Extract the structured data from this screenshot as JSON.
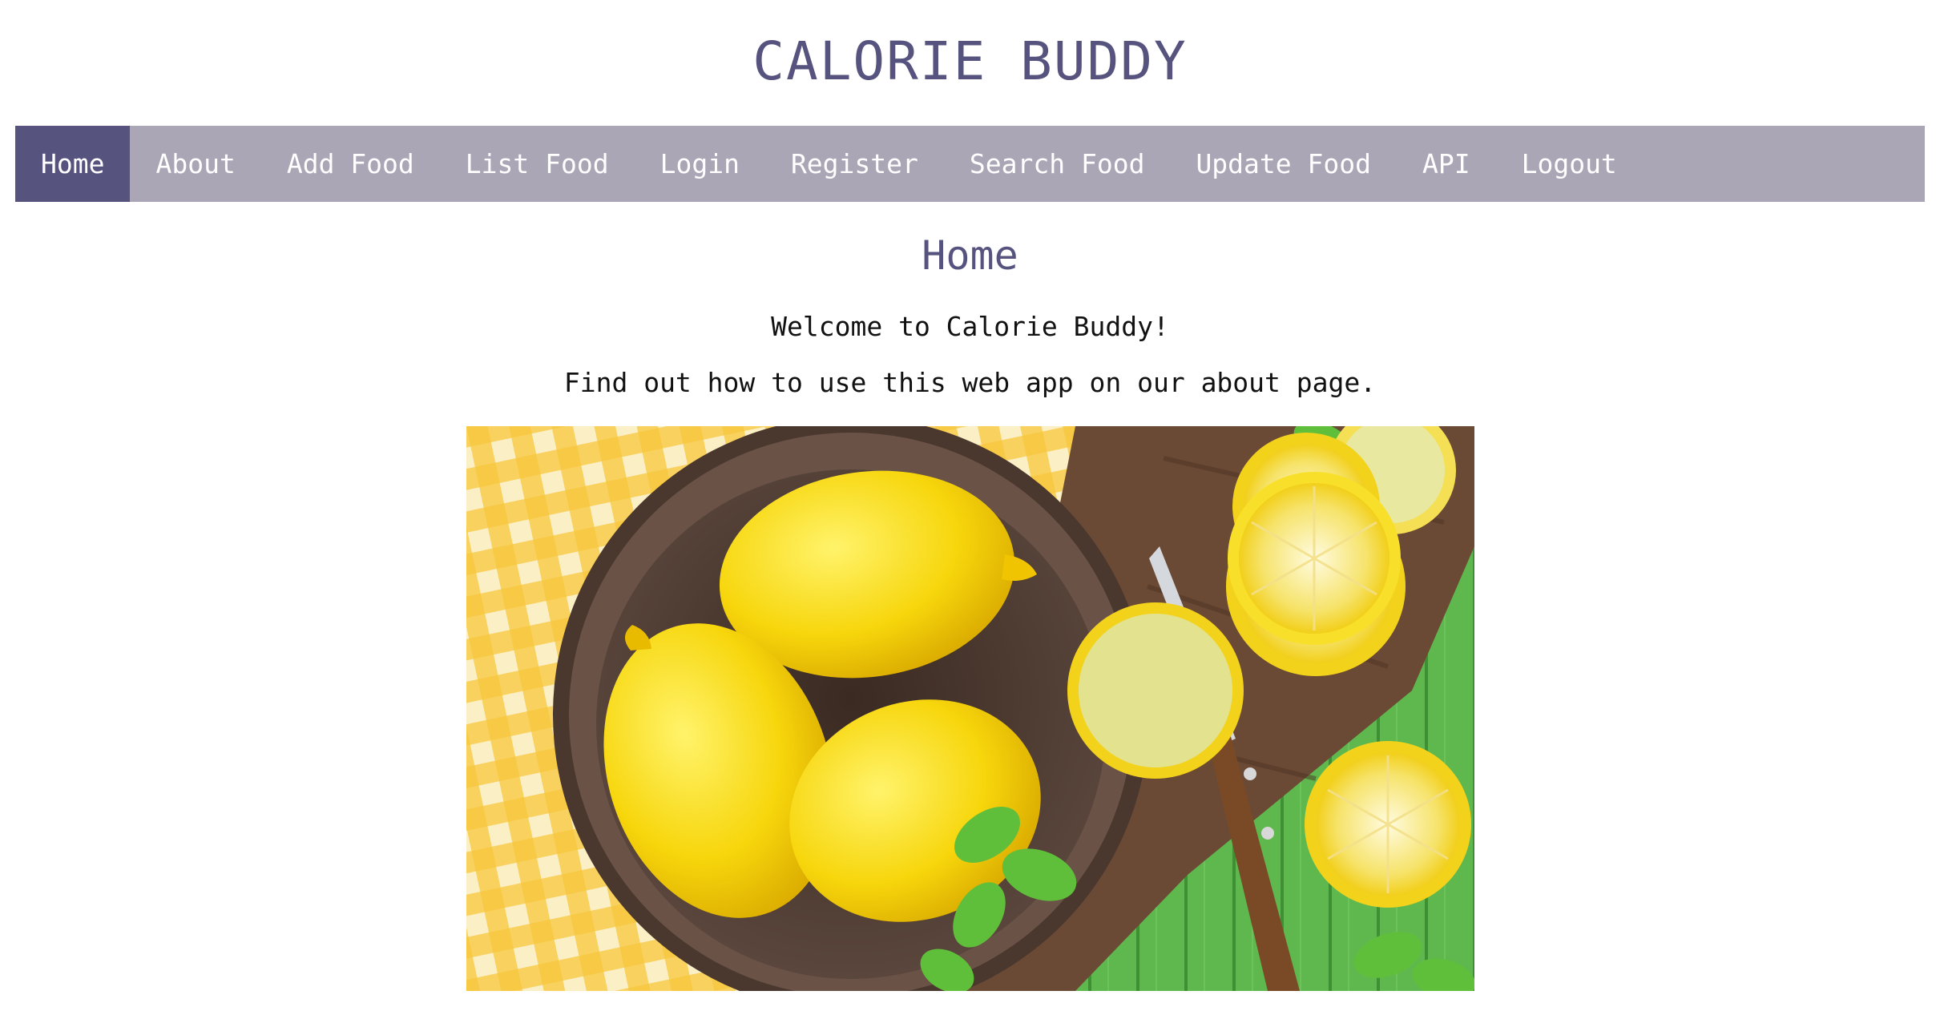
{
  "app": {
    "title": "CALORIE BUDDY"
  },
  "nav": {
    "items": [
      {
        "label": "Home",
        "active": true
      },
      {
        "label": "About"
      },
      {
        "label": "Add Food"
      },
      {
        "label": "List Food"
      },
      {
        "label": "Login"
      },
      {
        "label": "Register"
      },
      {
        "label": "Search Food"
      },
      {
        "label": "Update Food"
      },
      {
        "label": "API"
      },
      {
        "label": "Logout"
      }
    ]
  },
  "main": {
    "heading": "Home",
    "welcome": "Welcome to Calorie Buddy!",
    "about_hint": "Find out how to use this web app on our about page."
  },
  "colors": {
    "brand": "#56547f",
    "nav_background": "#aaa6b5",
    "nav_text": "#ffffff"
  }
}
